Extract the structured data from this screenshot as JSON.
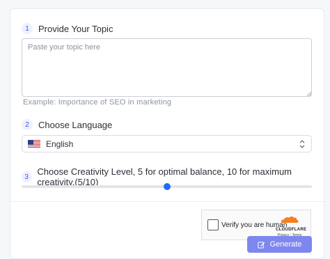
{
  "steps": [
    {
      "number": "1",
      "label": "Provide Your Topic"
    },
    {
      "number": "2",
      "label": "Choose Language"
    },
    {
      "number": "3",
      "label": "Choose Creativity Level, 5 for optimal balance, 10 for maximum creativity.(5/10)"
    }
  ],
  "topic": {
    "placeholder": "Paste your topic here",
    "value": "",
    "example": "Example:  Importance of SEO in marketing"
  },
  "language": {
    "selected": "English",
    "flag_icon": "us-flag-icon"
  },
  "creativity": {
    "value": 5,
    "min": 0,
    "max": 10
  },
  "captcha": {
    "label": "Verify you are human",
    "brand": "CLOUDFLARE",
    "privacy": "Privacy",
    "separator": "·",
    "terms": "Terms"
  },
  "generate": {
    "label": "Generate",
    "icon": "edit-icon"
  },
  "colors": {
    "accent": "#1f6bff",
    "button": "#7e86f0",
    "step_badge": "#eef0ff",
    "cloudflare": "#f38020"
  }
}
